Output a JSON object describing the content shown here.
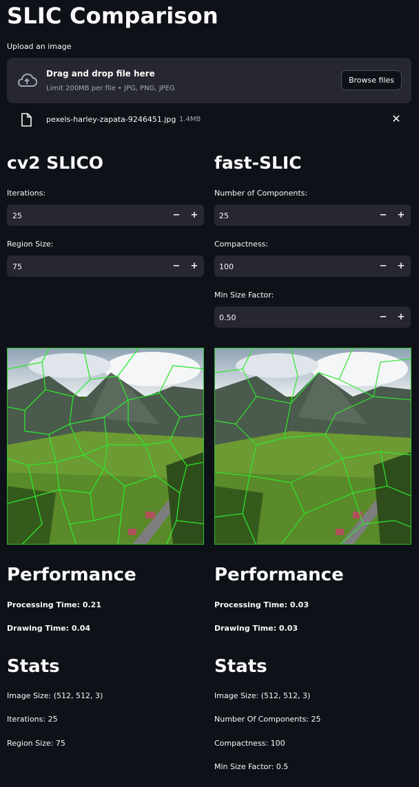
{
  "title": "SLIC Comparison",
  "uploader": {
    "label": "Upload an image",
    "drop_text": "Drag and drop file here",
    "limit_text": "Limit 200MB per file • JPG, PNG, JPEG",
    "browse_label": "Browse files",
    "file_name": "pexels-harley-zapata-9246451.jpg",
    "file_size": "1.4MB"
  },
  "left": {
    "heading": "cv2 SLICO",
    "iterations_label": "Iterations:",
    "iterations_value": "25",
    "region_size_label": "Region Size:",
    "region_size_value": "75",
    "perf_heading": "Performance",
    "processing_time": "Processing Time: 0.21",
    "drawing_time": "Drawing Time: 0.04",
    "stats_heading": "Stats",
    "stat_image_size": "Image Size: (512, 512, 3)",
    "stat_iterations": "Iterations: 25",
    "stat_region_size": "Region Size: 75"
  },
  "right": {
    "heading": "fast-SLIC",
    "components_label": "Number of Components:",
    "components_value": "25",
    "compactness_label": "Compactness:",
    "compactness_value": "100",
    "min_size_label": "Min Size Factor:",
    "min_size_value": "0.50",
    "perf_heading": "Performance",
    "processing_time": "Processing Time: 0.03",
    "drawing_time": "Drawing Time: 0.03",
    "stats_heading": "Stats",
    "stat_image_size": "Image Size: (512, 512, 3)",
    "stat_components": "Number Of Components: 25",
    "stat_compactness": "Compactness: 100",
    "stat_min_size": "Min Size Factor: 0.5"
  },
  "stepper": {
    "minus": "−",
    "plus": "+"
  },
  "colors": {
    "background": "#0e1117",
    "input_bg": "#262730",
    "segment_line": "#2fe62f"
  }
}
